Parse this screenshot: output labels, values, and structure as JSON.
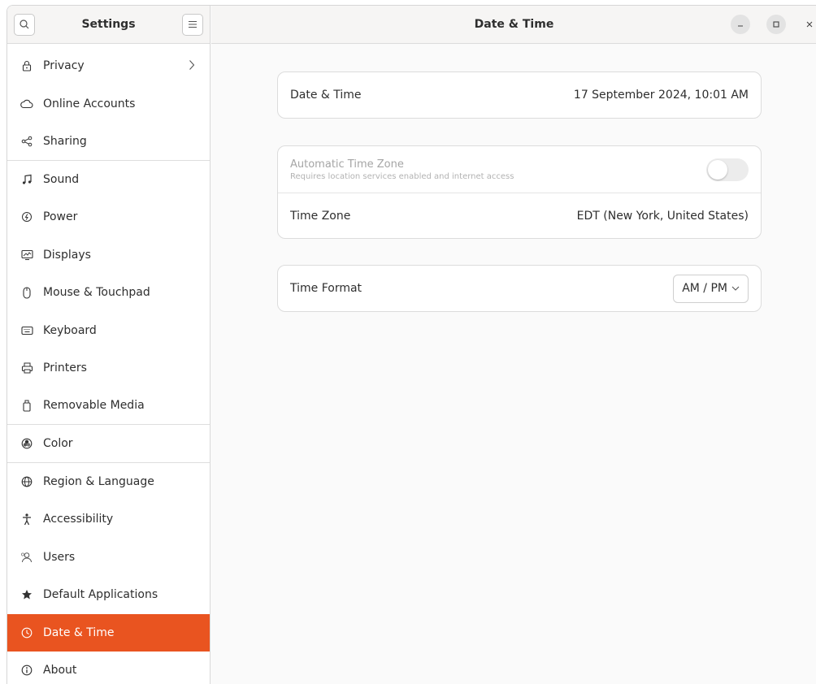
{
  "sidebar": {
    "title": "Settings",
    "items": [
      {
        "label": "Privacy"
      },
      {
        "label": "Online Accounts"
      },
      {
        "label": "Sharing"
      },
      {
        "label": "Sound"
      },
      {
        "label": "Power"
      },
      {
        "label": "Displays"
      },
      {
        "label": "Mouse & Touchpad"
      },
      {
        "label": "Keyboard"
      },
      {
        "label": "Printers"
      },
      {
        "label": "Removable Media"
      },
      {
        "label": "Color"
      },
      {
        "label": "Region & Language"
      },
      {
        "label": "Accessibility"
      },
      {
        "label": "Users"
      },
      {
        "label": "Default Applications"
      },
      {
        "label": "Date & Time"
      },
      {
        "label": "About"
      }
    ],
    "active_item": "Date & Time"
  },
  "header": {
    "title": "Date & Time"
  },
  "date_time": {
    "label": "Date & Time",
    "value": "17 September 2024, 10:01 AM"
  },
  "time_zone_card": {
    "auto_label": "Automatic Time Zone",
    "auto_sub": "Requires location services enabled and internet access",
    "auto_enabled": false,
    "tz_label": "Time Zone",
    "tz_value": "EDT (New York, United States)"
  },
  "time_format": {
    "label": "Time Format",
    "selected": "AM / PM"
  },
  "colors": {
    "accent": "#e95420"
  }
}
